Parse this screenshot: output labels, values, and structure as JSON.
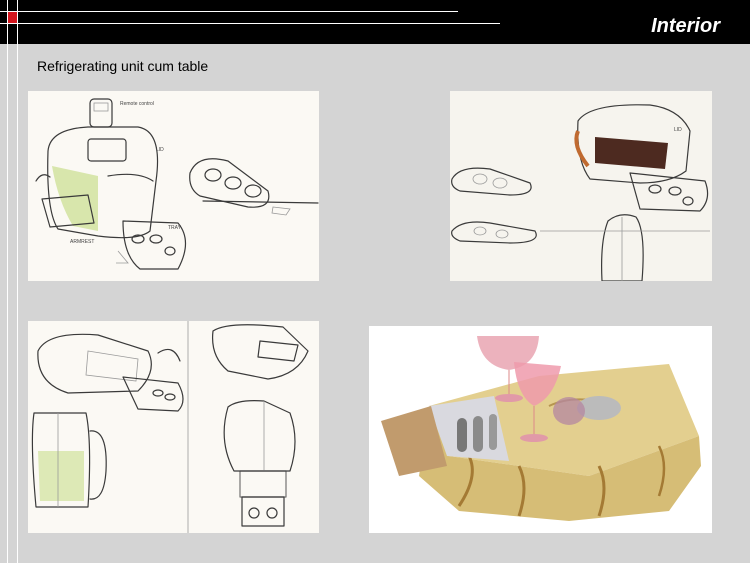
{
  "header": {
    "section_title": "Interior"
  },
  "slide": {
    "heading": "Refrigerating unit cum table"
  },
  "sketch_annotations": {
    "remote_control": "Remote control",
    "lid": "LID",
    "tray": "TRAY",
    "armrest": "ARMREST",
    "lid_2": "LID"
  },
  "colors": {
    "header_bar": "#000000",
    "accent_red": "#d4161e",
    "slide_background": "#d4d4d4"
  }
}
